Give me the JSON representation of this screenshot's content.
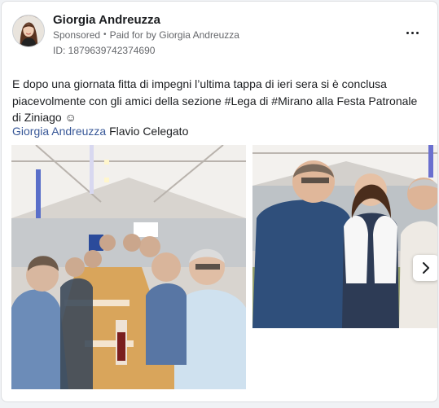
{
  "post": {
    "author": "Giorgia Andreuzza",
    "sponsored": "Sponsored",
    "separator": "•",
    "paid_for": "Paid for by Giorgia Andreuzza",
    "ad_id": "ID: 1879639742374690",
    "text": "E dopo una giornata fitta di impegni l’ultima tappa di ieri sera si è conclusa piacevolmente con gli amici della sezione #Lega di #Mirano alla Festa Patronale di Ziniago ☺",
    "mentions": [
      {
        "label": "Giorgia Andreuzza",
        "link": true
      },
      {
        "label": "Flavio Celegato",
        "link": false
      }
    ]
  },
  "icons": {
    "more": "more-options-icon",
    "next": "chevron-right-icon",
    "avatar": "profile-avatar"
  },
  "colors": {
    "link": "#385898",
    "secondary_text": "#65676b",
    "primary_text": "#1c1e21"
  }
}
